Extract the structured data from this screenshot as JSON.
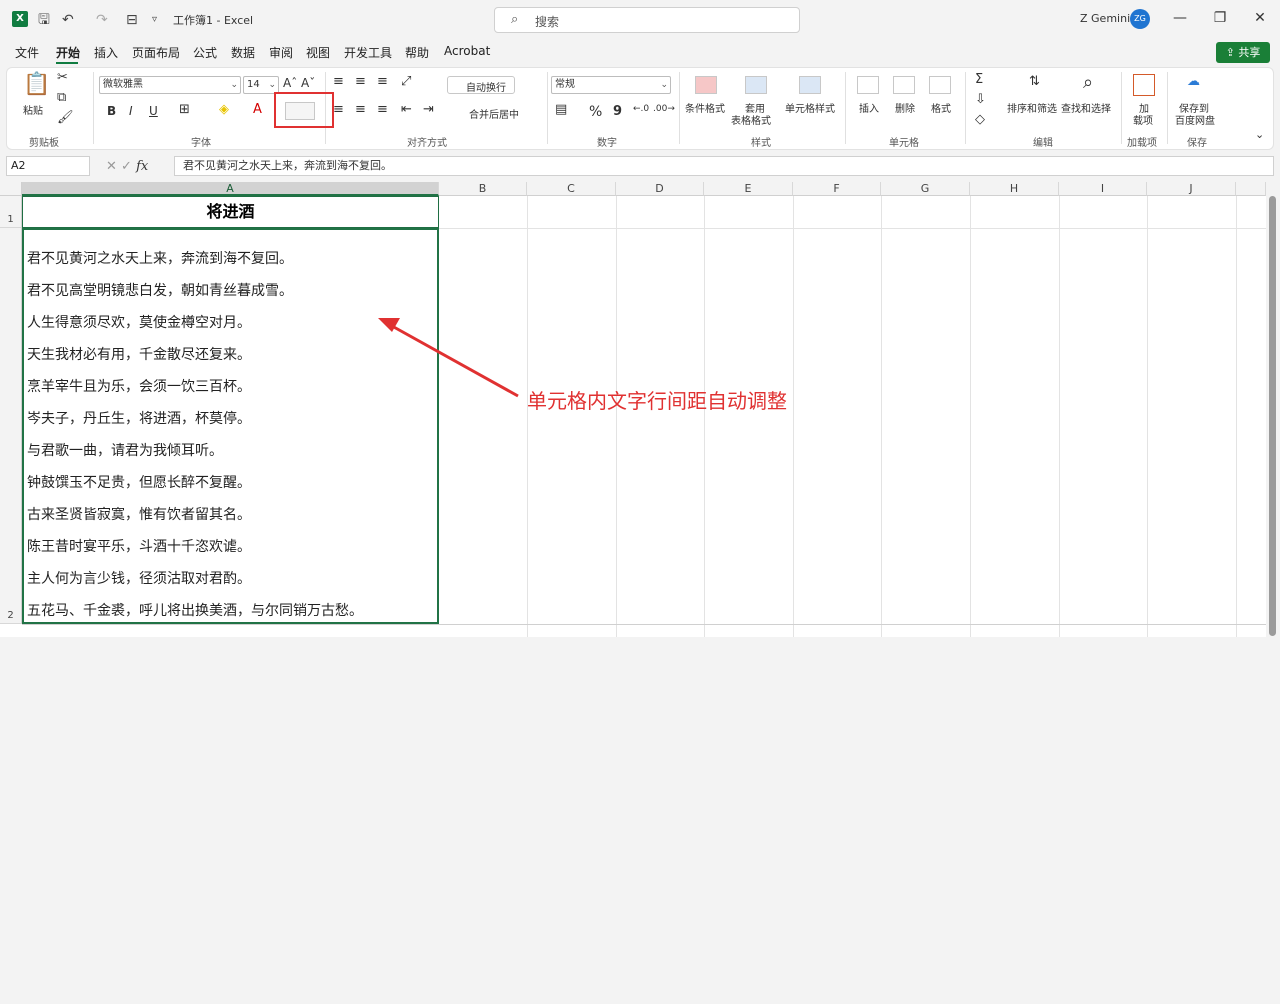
{
  "titlebar": {
    "app_logo": "X",
    "doc_title": "工作簿1 - Excel",
    "search_placeholder": "搜索",
    "user_name": "Z Gemini",
    "avatar_initials": "ZG"
  },
  "menu": {
    "tabs": [
      "文件",
      "开始",
      "插入",
      "页面布局",
      "公式",
      "数据",
      "审阅",
      "视图",
      "开发工具",
      "帮助",
      "Acrobat"
    ],
    "active_tab": "开始",
    "share_label": "共享"
  },
  "ribbon": {
    "clipboard": {
      "paste": "粘贴",
      "label": "剪贴板"
    },
    "font": {
      "name": "微软雅黑",
      "size": "14",
      "bold": "B",
      "italic": "I",
      "underline": "U",
      "label": "字体"
    },
    "align": {
      "wrap": "自动换行",
      "merge": "合并后居中",
      "label": "对齐方式"
    },
    "number": {
      "format": "常规",
      "percent": "%",
      "comma": "9",
      "label": "数字"
    },
    "styles": {
      "cond": "条件格式",
      "table1": "套用",
      "table2": "表格格式",
      "cell": "单元格样式",
      "label": "样式"
    },
    "cells": {
      "insert": "插入",
      "delete": "删除",
      "format": "格式",
      "label": "单元格"
    },
    "edit": {
      "sortfilter": "排序和筛选",
      "find": "查找和选择",
      "label": "编辑"
    },
    "addins": {
      "a1": "加",
      "a2": "载项",
      "label": "加载项"
    },
    "save": {
      "s1": "保存到",
      "s2": "百度网盘",
      "label": "保存"
    }
  },
  "formula_bar": {
    "name_box": "A2",
    "fx": "fx",
    "content": "君不见黄河之水天上来，奔流到海不复回。"
  },
  "sheet": {
    "columns": [
      "A",
      "B",
      "C",
      "D",
      "E",
      "F",
      "G",
      "H",
      "I",
      "J"
    ],
    "rows": [
      "1",
      "2"
    ],
    "a1": "将进酒",
    "a2_lines": [
      "君不见黄河之水天上来，奔流到海不复回。",
      "君不见高堂明镜悲白发，朝如青丝暮成雪。",
      "人生得意须尽欢，莫使金樽空对月。",
      "天生我材必有用，千金散尽还复来。",
      "烹羊宰牛且为乐，会须一饮三百杯。",
      "岑夫子，丹丘生，将进酒，杯莫停。",
      "与君歌一曲，请君为我倾耳听。",
      "钟鼓馔玉不足贵，但愿长醉不复醒。",
      "古来圣贤皆寂寞，惟有饮者留其名。",
      "陈王昔时宴平乐，斗酒十千恣欢谑。",
      "主人何为言少钱，径须沽取对君酌。",
      "五花马、千金裘，呼儿将出换美酒，与尔同销万古愁。"
    ]
  },
  "annotation": "单元格内文字行间距自动调整",
  "colors": {
    "accent": "#217346",
    "annotation": "#e03131"
  }
}
